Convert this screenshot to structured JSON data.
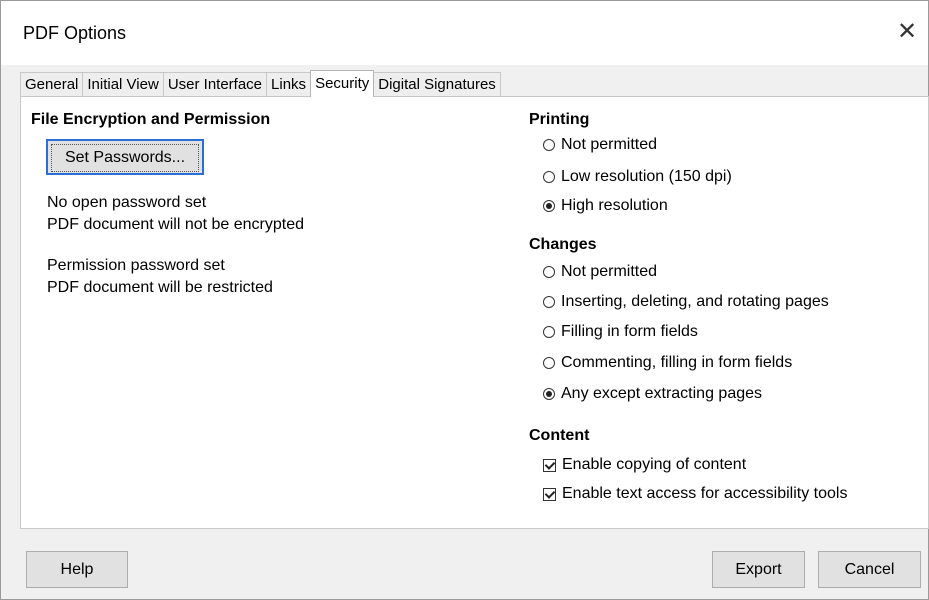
{
  "window": {
    "title": "PDF Options",
    "close_glyph": "✕"
  },
  "tabs": [
    {
      "label": "General"
    },
    {
      "label": "Initial View"
    },
    {
      "label": "User Interface"
    },
    {
      "label": "Links"
    },
    {
      "label": "Security",
      "active": true
    },
    {
      "label": "Digital Signatures"
    }
  ],
  "encryption": {
    "heading": "File Encryption and Permission",
    "set_passwords_label": "Set Passwords...",
    "status_line1": "No open password set",
    "status_line2": "PDF document will not be encrypted",
    "status_line3": "Permission password set",
    "status_line4": "PDF document will be restricted"
  },
  "printing": {
    "heading": "Printing",
    "options": [
      {
        "label": "Not permitted",
        "selected": false
      },
      {
        "label": "Low resolution (150 dpi)",
        "selected": false
      },
      {
        "label": "High resolution",
        "selected": true
      }
    ]
  },
  "changes": {
    "heading": "Changes",
    "options": [
      {
        "label": "Not permitted",
        "selected": false
      },
      {
        "label": "Inserting, deleting, and rotating pages",
        "selected": false
      },
      {
        "label": "Filling in form fields",
        "selected": false
      },
      {
        "label": "Commenting, filling in form fields",
        "selected": false
      },
      {
        "label": "Any except extracting pages",
        "selected": true
      }
    ]
  },
  "content": {
    "heading": "Content",
    "options": [
      {
        "label": "Enable copying of content",
        "checked": true
      },
      {
        "label": "Enable text access for accessibility tools",
        "checked": true
      }
    ]
  },
  "footer": {
    "help_label": "Help",
    "export_label": "Export",
    "cancel_label": "Cancel"
  }
}
